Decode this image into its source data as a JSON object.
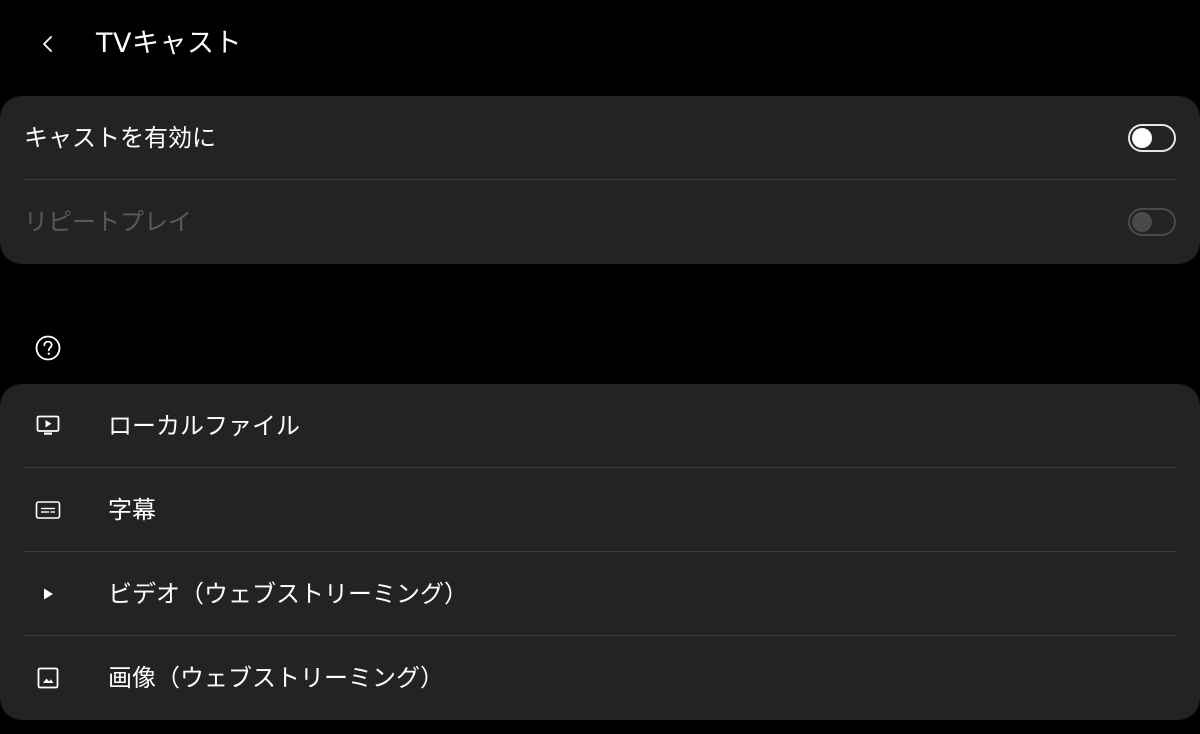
{
  "header": {
    "back_icon": "chevron-left-icon",
    "title": "TVキャスト"
  },
  "settings": {
    "enable_cast": {
      "label": "キャストを有効に",
      "state": "off",
      "enabled": true
    },
    "repeat_play": {
      "label": "リピートプレイ",
      "state": "off",
      "enabled": false
    }
  },
  "help_icon": "question-circle-icon",
  "cast_types": {
    "items": [
      {
        "icon": "monitor-play-icon",
        "label": "ローカルファイル"
      },
      {
        "icon": "subtitles-icon",
        "label": "字幕"
      },
      {
        "icon": "play-icon",
        "label": "ビデオ（ウェブストリーミング）"
      },
      {
        "icon": "image-icon",
        "label": "画像（ウェブストリーミング）"
      }
    ]
  },
  "colors": {
    "background": "#000000",
    "card": "#232323",
    "divider": "#3a3a3a",
    "text": "#ffffff",
    "text_disabled": "#5a5a5a"
  }
}
